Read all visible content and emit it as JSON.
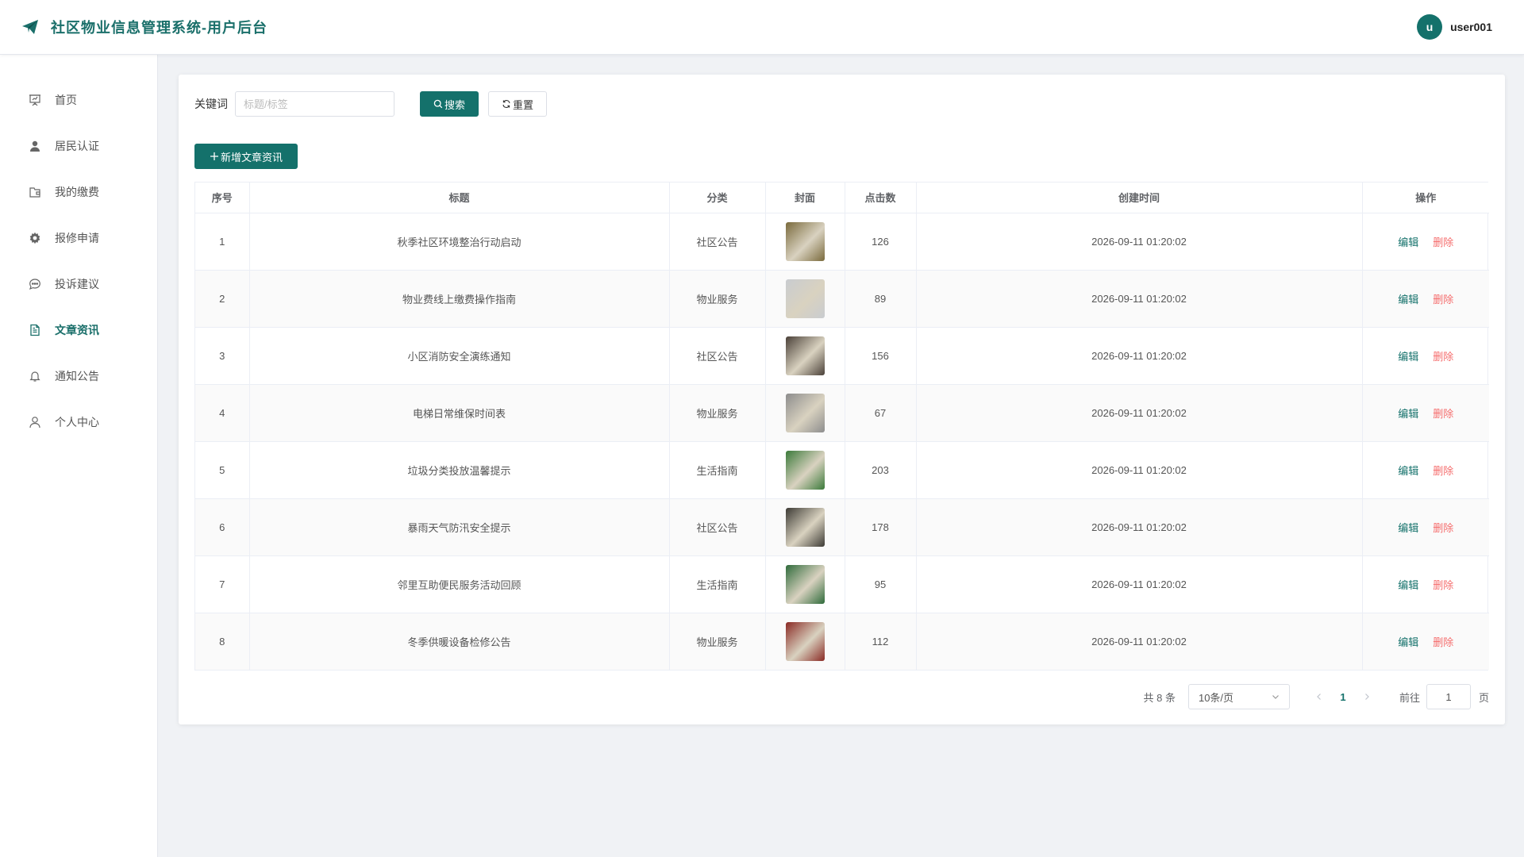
{
  "header": {
    "title": "社区物业信息管理系统-用户后台",
    "avatar_letter": "u",
    "username": "user001"
  },
  "sidebar": {
    "items": [
      {
        "label": "首页",
        "icon": "presentation-board-icon",
        "active": false
      },
      {
        "label": "居民认证",
        "icon": "user-filled-icon",
        "active": false
      },
      {
        "label": "我的缴费",
        "icon": "wallet-icon",
        "active": false
      },
      {
        "label": "报修申请",
        "icon": "gear-icon",
        "active": false
      },
      {
        "label": "投诉建议",
        "icon": "chat-dots-icon",
        "active": false
      },
      {
        "label": "文章资讯",
        "icon": "document-icon",
        "active": true
      },
      {
        "label": "通知公告",
        "icon": "bell-icon",
        "active": false
      },
      {
        "label": "个人中心",
        "icon": "user-outline-icon",
        "active": false
      }
    ]
  },
  "search": {
    "label": "关键词",
    "placeholder": "标题/标签",
    "value": "",
    "search_label": "搜索",
    "reset_label": "重置"
  },
  "toolbar": {
    "add_label": "新增文章资讯"
  },
  "table": {
    "headers": [
      "序号",
      "标题",
      "分类",
      "封面",
      "点击数",
      "创建时间",
      "操作"
    ],
    "edit_label": "编辑",
    "delete_label": "删除",
    "rows": [
      {
        "no": "1",
        "title": "秋季社区环境整治行动启动",
        "category": "社区公告",
        "clicks": "126",
        "created": "2026-09-11 01:20:02",
        "cover_color": "#7a6a3c"
      },
      {
        "no": "2",
        "title": "物业费线上缴费操作指南",
        "category": "物业服务",
        "clicks": "89",
        "created": "2026-09-11 01:20:02",
        "cover_color": "#c9ccd0"
      },
      {
        "no": "3",
        "title": "小区消防安全演练通知",
        "category": "社区公告",
        "clicks": "156",
        "created": "2026-09-11 01:20:02",
        "cover_color": "#4a4038"
      },
      {
        "no": "4",
        "title": "电梯日常维保时间表",
        "category": "物业服务",
        "clicks": "67",
        "created": "2026-09-11 01:20:02",
        "cover_color": "#8d8d8d"
      },
      {
        "no": "5",
        "title": "垃圾分类投放温馨提示",
        "category": "生活指南",
        "clicks": "203",
        "created": "2026-09-11 01:20:02",
        "cover_color": "#3b7a3a"
      },
      {
        "no": "6",
        "title": "暴雨天气防汛安全提示",
        "category": "社区公告",
        "clicks": "178",
        "created": "2026-09-11 01:20:02",
        "cover_color": "#3c3a34"
      },
      {
        "no": "7",
        "title": "邻里互助便民服务活动回顾",
        "category": "生活指南",
        "clicks": "95",
        "created": "2026-09-11 01:20:02",
        "cover_color": "#2f6b3b"
      },
      {
        "no": "8",
        "title": "冬季供暖设备检修公告",
        "category": "物业服务",
        "clicks": "112",
        "created": "2026-09-11 01:20:02",
        "cover_color": "#8a2a24"
      }
    ]
  },
  "pagination": {
    "total_text": "共 8 条",
    "page_size": "10条/页",
    "current_page": "1",
    "goto_label": "前往",
    "goto_value": "1",
    "page_suffix": "页"
  },
  "colors": {
    "accent": "#14716b",
    "danger": "#f56c6c"
  }
}
